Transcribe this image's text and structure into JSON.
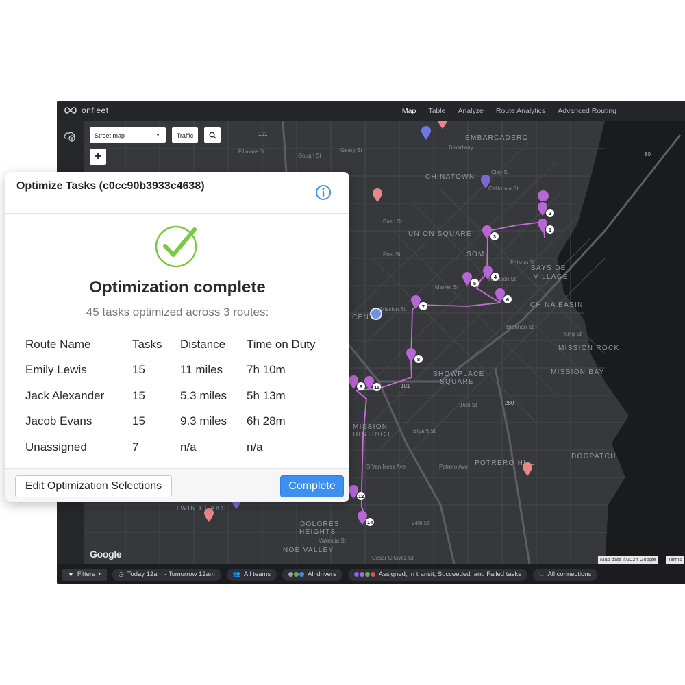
{
  "app": {
    "logo_text": "onfleet",
    "nav": [
      "Map",
      "Table",
      "Analyze",
      "Route Analytics",
      "Advanced Routing"
    ],
    "active_nav": "Map"
  },
  "map": {
    "map_type": "Street map",
    "traffic_label": "Traffic",
    "zoom_in": "+",
    "google": "Google",
    "attribution": "Map data ©2024 Google",
    "terms": "Terms",
    "areas": [
      "EMBARCADERO",
      "CHINATOWN",
      "UNION SQUARE",
      "SOM",
      "BAYSIDE",
      "VILLAGE",
      "CHINA BASIN",
      "CENT",
      "MISSION ROCK",
      "MISSION BAY",
      "SHOWPLACE",
      "SQUARE",
      "MISSION",
      "DISTRICT",
      "POTRERO HILL",
      "DOGPATCH",
      "TWIN PEAKS",
      "DOLORES",
      "HEIGHTS",
      "NOE VALLEY"
    ],
    "streets": [
      "Broadway",
      "Clay St",
      "California St",
      "Bush St",
      "Post St",
      "Folsom St",
      "Harrison St",
      "Market St",
      "Brannan St",
      "King St",
      "16th St",
      "24th St",
      "Cesar Chavez St",
      "S Van Ness Ave",
      "Bryant St",
      "Potrero Ave",
      "Mission St",
      "Valencia St",
      "Geary St",
      "Fillmore St",
      "Gough St"
    ],
    "highways": [
      "101",
      "80",
      "280"
    ],
    "stops": [
      "1",
      "2",
      "3",
      "4",
      "5",
      "6",
      "7",
      "8",
      "9",
      "11",
      "12",
      "14"
    ],
    "route_color": "#c86ed8",
    "pin_colors": {
      "route": "#b865d6",
      "blue": "#6e78e6",
      "pink": "#e8868a",
      "violet": "#7a68d8"
    }
  },
  "filters": {
    "filters_label": "Filters",
    "time": "Today 12am - Tomorrow 12am",
    "teams": "All teams",
    "drivers": "All drivers",
    "tasks": "Assigned, In transit, Succeeded, and Failed tasks",
    "connections": "All connections",
    "driver_dot_colors": [
      "#9ea0a6",
      "#5bb05b",
      "#4a86e8"
    ],
    "task_dot_colors": [
      "#7c6cf0",
      "#b865d6",
      "#5bb05b",
      "#e05050"
    ]
  },
  "dialog": {
    "title": "Optimize Tasks (c0cc90b3933c4638)",
    "headline": "Optimization complete",
    "subtitle": "45 tasks optimized across 3 routes:",
    "columns": [
      "Route Name",
      "Tasks",
      "Distance",
      "Time on Duty"
    ],
    "rows": [
      [
        "Emily Lewis",
        "15",
        "11 miles",
        "7h 10m"
      ],
      [
        "Jack Alexander",
        "15",
        "5.3 miles",
        "5h 13m"
      ],
      [
        "Jacob Evans",
        "15",
        "9.3 miles",
        "6h 28m"
      ],
      [
        "Unassigned",
        "7",
        "n/a",
        "n/a"
      ]
    ],
    "edit_button": "Edit Optimization Selections",
    "complete_button": "Complete",
    "check_color": "#7ac943",
    "accent_color": "#3d8ff0"
  }
}
